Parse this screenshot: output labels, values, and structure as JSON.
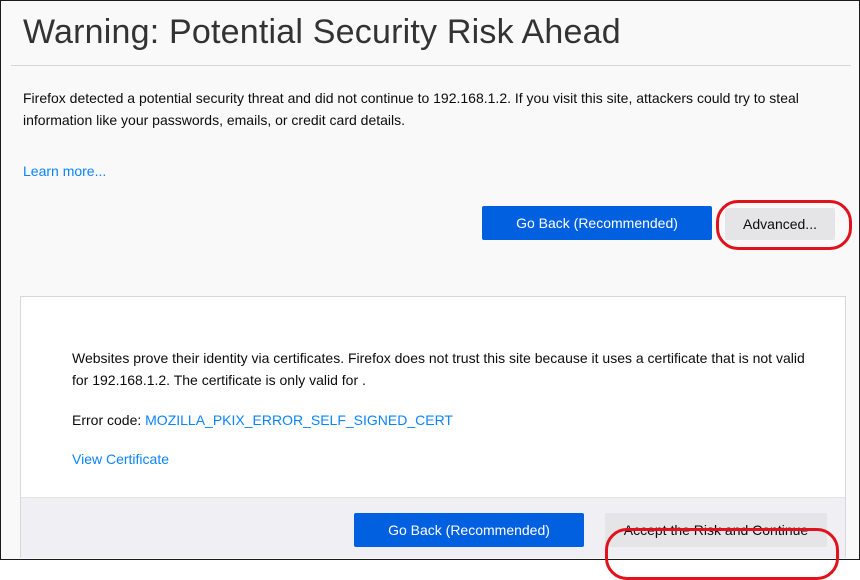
{
  "page": {
    "title": "Warning: Potential Security Risk Ahead",
    "intro": "Firefox detected a potential security threat and did not continue to 192.168.1.2. If you visit this site, attackers could try to steal information like your passwords, emails, or credit card details.",
    "learn_more": "Learn more...",
    "buttons": {
      "go_back": "Go Back (Recommended)",
      "advanced": "Advanced..."
    }
  },
  "advanced_panel": {
    "description": "Websites prove their identity via certificates. Firefox does not trust this site because it uses a certificate that is not valid for 192.168.1.2. The certificate is only valid for .",
    "error_label": "Error code:",
    "error_code": "MOZILLA_PKIX_ERROR_SELF_SIGNED_CERT",
    "view_certificate": "View Certificate",
    "buttons": {
      "go_back": "Go Back (Recommended)",
      "accept": "Accept the Risk and Continue"
    }
  },
  "colors": {
    "primary_button": "#0060df",
    "link": "#0a84ff",
    "highlight_ring": "#e0121b"
  }
}
